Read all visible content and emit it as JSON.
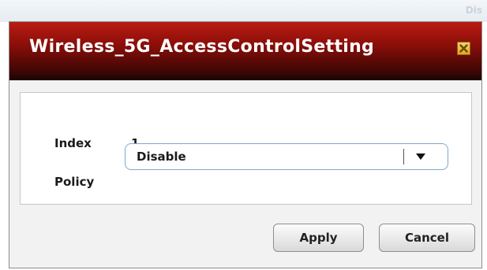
{
  "background": {
    "faded_text": "Dis"
  },
  "dialog": {
    "title": "Wireless_5G_AccessControlSetting",
    "close_icon": "close-icon",
    "index": {
      "label": "Index",
      "value": "1"
    },
    "policy": {
      "label": "Policy",
      "selected": "Disable",
      "dropdown_icon": "chevron-down-icon"
    },
    "buttons": {
      "apply": "Apply",
      "cancel": "Cancel"
    }
  },
  "colors": {
    "title_bar_top": "#b91b13",
    "title_bar_bottom": "#1a0403",
    "close_button": "#e4a623",
    "select_border": "#7fa7cf"
  }
}
